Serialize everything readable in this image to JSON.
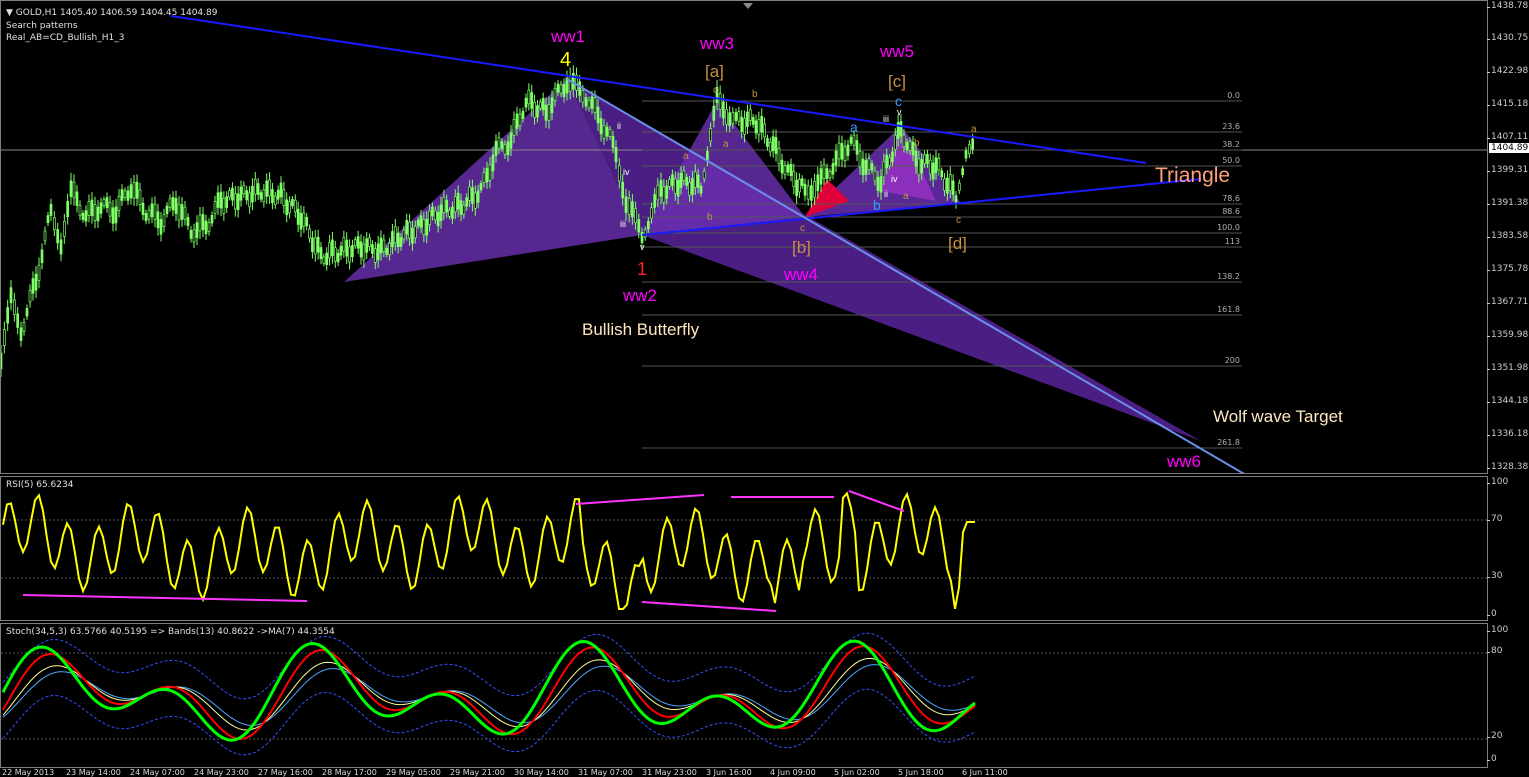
{
  "chart_header": {
    "symbol": "▼ GOLD,H1",
    "ohlc": "1405.40 1406.59 1404.45 1404.89",
    "line2": "Search patterns",
    "line3": "Real_AB=CD_Bullish_H1_3"
  },
  "current_price": "1404.89",
  "price_axis": [
    "1438.78",
    "1430.75",
    "1422.98",
    "1415.18",
    "1407.11",
    "1399.31",
    "1391.38",
    "1383.58",
    "1375.78",
    "1367.71",
    "1359.98",
    "1351.98",
    "1344.18",
    "1336.18",
    "1328.38"
  ],
  "fib_levels": [
    "0.0",
    "23.6",
    "38.2",
    "50.0",
    "78.6",
    "88.6",
    "100.0",
    "113",
    "138.2",
    "161.8",
    "200",
    "261.8"
  ],
  "wave_labels": {
    "ww1": "ww1",
    "four": "4",
    "ww3": "ww3",
    "a_bracket": "[a]",
    "ww5": "ww5",
    "c_bracket": "[c]",
    "one": "1",
    "ww2": "ww2",
    "b_bracket": "[b]",
    "ww4": "ww4",
    "d_bracket": "[d]",
    "ww6": "ww6",
    "c_blue": "c",
    "a_blue": "a",
    "b_blue": "b",
    "triangle": "Triangle",
    "bullish_butterfly": "Bullish Butterfly",
    "wolf_target": "Wolf wave Target"
  },
  "minor_labels": {
    "ii": "ii",
    "iv": "iv",
    "iii": "iii",
    "v": "v",
    "b": "b",
    "a": "a",
    "c": "c"
  },
  "rsi": {
    "title": "RSI(5) 65.6234",
    "axis": [
      "100",
      "70",
      "30",
      "0"
    ]
  },
  "stoch": {
    "title": "Stoch(34,5,3) 63.5766 40.5195  => Bands(13) 40.8622  ->MA(7) 44.3554",
    "axis": [
      "100",
      "80",
      "20",
      "0"
    ]
  },
  "time_axis": [
    "22 May 2013",
    "23 May 14:00",
    "24 May 07:00",
    "24 May 23:00",
    "27 May 16:00",
    "28 May 17:00",
    "29 May 05:00",
    "29 May 21:00",
    "30 May 14:00",
    "31 May 07:00",
    "31 May 23:00",
    "3 Jun 16:00",
    "4 Jun 09:00",
    "5 Jun 02:00",
    "5 Jun 18:00",
    "6 Jun 11:00"
  ],
  "colors": {
    "candle": "#7fff66",
    "wave_magenta": "#ff00ff",
    "wave_gold": "#c89040",
    "trendline": "#1a1aff",
    "triangle_text": "#ffa07a",
    "rsi_line": "#ffff00",
    "stoch_main": "#00ff00",
    "stoch_signal": "#ff0000"
  }
}
